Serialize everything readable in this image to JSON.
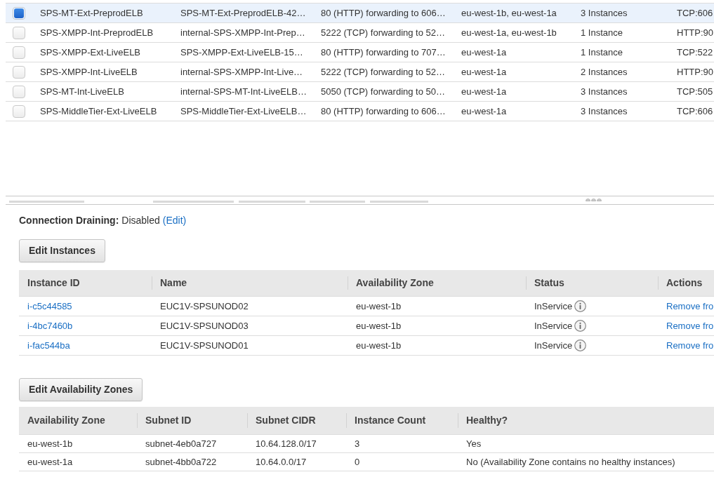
{
  "load_balancers": {
    "rows": [
      {
        "selected": true,
        "cells": [
          "SPS-MT-Ext-PreprodELB",
          "SPS-MT-Ext-PreprodELB-42…",
          "80 (HTTP) forwarding to 606…",
          "eu-west-1b, eu-west-1a",
          "3 Instances",
          "TCP:606"
        ]
      },
      {
        "selected": false,
        "cells": [
          "SPS-XMPP-Int-PreprodELB",
          "internal-SPS-XMPP-Int-Prep…",
          "5222 (TCP) forwarding to 52…",
          "eu-west-1a, eu-west-1b",
          "1 Instance",
          "HTTP:90"
        ]
      },
      {
        "selected": false,
        "cells": [
          "SPS-XMPP-Ext-LiveELB",
          "SPS-XMPP-Ext-LiveELB-15…",
          "80 (HTTP) forwarding to 707…",
          "eu-west-1a",
          "1 Instance",
          "TCP:522"
        ]
      },
      {
        "selected": false,
        "cells": [
          "SPS-XMPP-Int-LiveELB",
          "internal-SPS-XMPP-Int-Live…",
          "5222 (TCP) forwarding to 52…",
          "eu-west-1a",
          "2 Instances",
          "HTTP:90"
        ]
      },
      {
        "selected": false,
        "cells": [
          "SPS-MT-Int-LiveELB",
          "internal-SPS-MT-Int-LiveELB…",
          "5050 (TCP) forwarding to 50…",
          "eu-west-1a",
          "3 Instances",
          "TCP:505"
        ]
      },
      {
        "selected": false,
        "cells": [
          "SPS-MiddleTier-Ext-LiveELB",
          "SPS-MiddleTier-Ext-LiveELB…",
          "80 (HTTP) forwarding to 606…",
          "eu-west-1a",
          "3 Instances",
          "TCP:606"
        ]
      }
    ]
  },
  "connection_draining": {
    "label": "Connection Draining:",
    "value": "Disabled",
    "edit_link": "(Edit)"
  },
  "instances": {
    "edit_button": "Edit Instances",
    "columns": [
      "Instance ID",
      "Name",
      "Availability Zone",
      "Status",
      "Actions"
    ],
    "rows": [
      {
        "instance_id": "i-c5c44585",
        "name": "EUC1V-SPSUNOD02",
        "availability_zone": "eu-west-1b",
        "status": "InService",
        "action": "Remove fro"
      },
      {
        "instance_id": "i-4bc7460b",
        "name": "EUC1V-SPSUNOD03",
        "availability_zone": "eu-west-1b",
        "status": "InService",
        "action": "Remove fro"
      },
      {
        "instance_id": "i-fac544ba",
        "name": "EUC1V-SPSUNOD01",
        "availability_zone": "eu-west-1b",
        "status": "InService",
        "action": "Remove fro"
      }
    ]
  },
  "availability_zones": {
    "edit_button": "Edit Availability Zones",
    "columns": [
      "Availability Zone",
      "Subnet ID",
      "Subnet CIDR",
      "Instance Count",
      "Healthy?"
    ],
    "rows": [
      {
        "availability_zone": "eu-west-1b",
        "subnet_id": "subnet-4eb0a727",
        "subnet_cidr": "10.64.128.0/17",
        "instance_count": "3",
        "healthy": "Yes"
      },
      {
        "availability_zone": "eu-west-1a",
        "subnet_id": "subnet-4bb0a722",
        "subnet_cidr": "10.64.0.0/17",
        "instance_count": "0",
        "healthy": "No (Availability Zone contains no healthy instances)"
      }
    ]
  }
}
